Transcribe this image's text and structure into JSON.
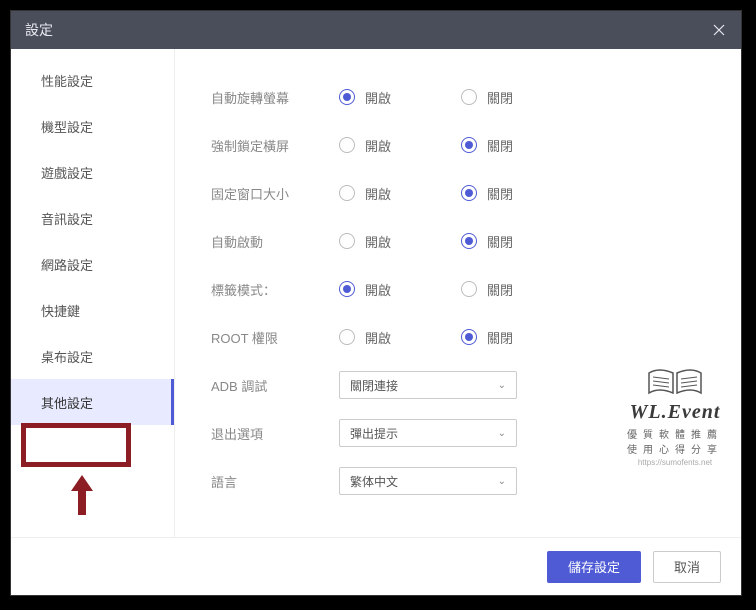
{
  "title": "設定",
  "sidebar": {
    "items": [
      {
        "label": "性能設定"
      },
      {
        "label": "機型設定"
      },
      {
        "label": "遊戲設定"
      },
      {
        "label": "音訊設定"
      },
      {
        "label": "網路設定"
      },
      {
        "label": "快捷鍵"
      },
      {
        "label": "桌布設定"
      },
      {
        "label": "其他設定"
      }
    ]
  },
  "options": {
    "on": "開啟",
    "off": "關閉",
    "rows": [
      {
        "label": "自動旋轉螢幕",
        "value": "on"
      },
      {
        "label": "強制鎖定橫屏",
        "value": "off"
      },
      {
        "label": "固定窗口大小",
        "value": "off"
      },
      {
        "label": "自動啟動",
        "value": "off"
      },
      {
        "label": "標籤模式：",
        "value": "on"
      },
      {
        "label": "ROOT 權限",
        "value": "off"
      }
    ],
    "adb": {
      "label": "ADB 調試",
      "value": "關閉連接"
    },
    "exit": {
      "label": "退出選項",
      "value": "彈出提示"
    },
    "lang": {
      "label": "語言",
      "value": "繁体中文"
    }
  },
  "footer": {
    "save": "儲存設定",
    "cancel": "取消"
  },
  "watermark": {
    "brand": "WL.Event",
    "sub": "優質軟體推薦",
    "sub2": "使用心得分享",
    "url": "https://sumofents.net"
  }
}
